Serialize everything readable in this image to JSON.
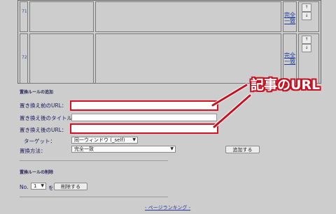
{
  "table": {
    "rows": [
      {
        "num": "71",
        "match": "完全一致",
        "up": "↑",
        "down": "↓"
      },
      {
        "num": "72",
        "match": "完全一致",
        "up": "↑",
        "down": "↓"
      }
    ]
  },
  "add_section": {
    "title": "置換ルールの追加",
    "before_url_label": "置き換え前のURL：",
    "before_url_value": "",
    "after_title_label": "置き換え後のタイトル：",
    "after_title_value": "",
    "after_url_label": "置き換え後のURL：",
    "after_url_value": "",
    "target_label": "ターゲット：",
    "target_value": "同一ウィンドウ (_self)",
    "method_label": "置換方法：",
    "method_value": "完全一致",
    "add_button": "追加する"
  },
  "delete_section": {
    "title": "置換ルールの削除",
    "no_label": "No.",
    "no_value": "1",
    "wo_label": "を",
    "delete_button": "削除する"
  },
  "annotation": {
    "text": "記事のURL",
    "color": "#c81020"
  },
  "footer": {
    "link": "- ページランキング -"
  }
}
